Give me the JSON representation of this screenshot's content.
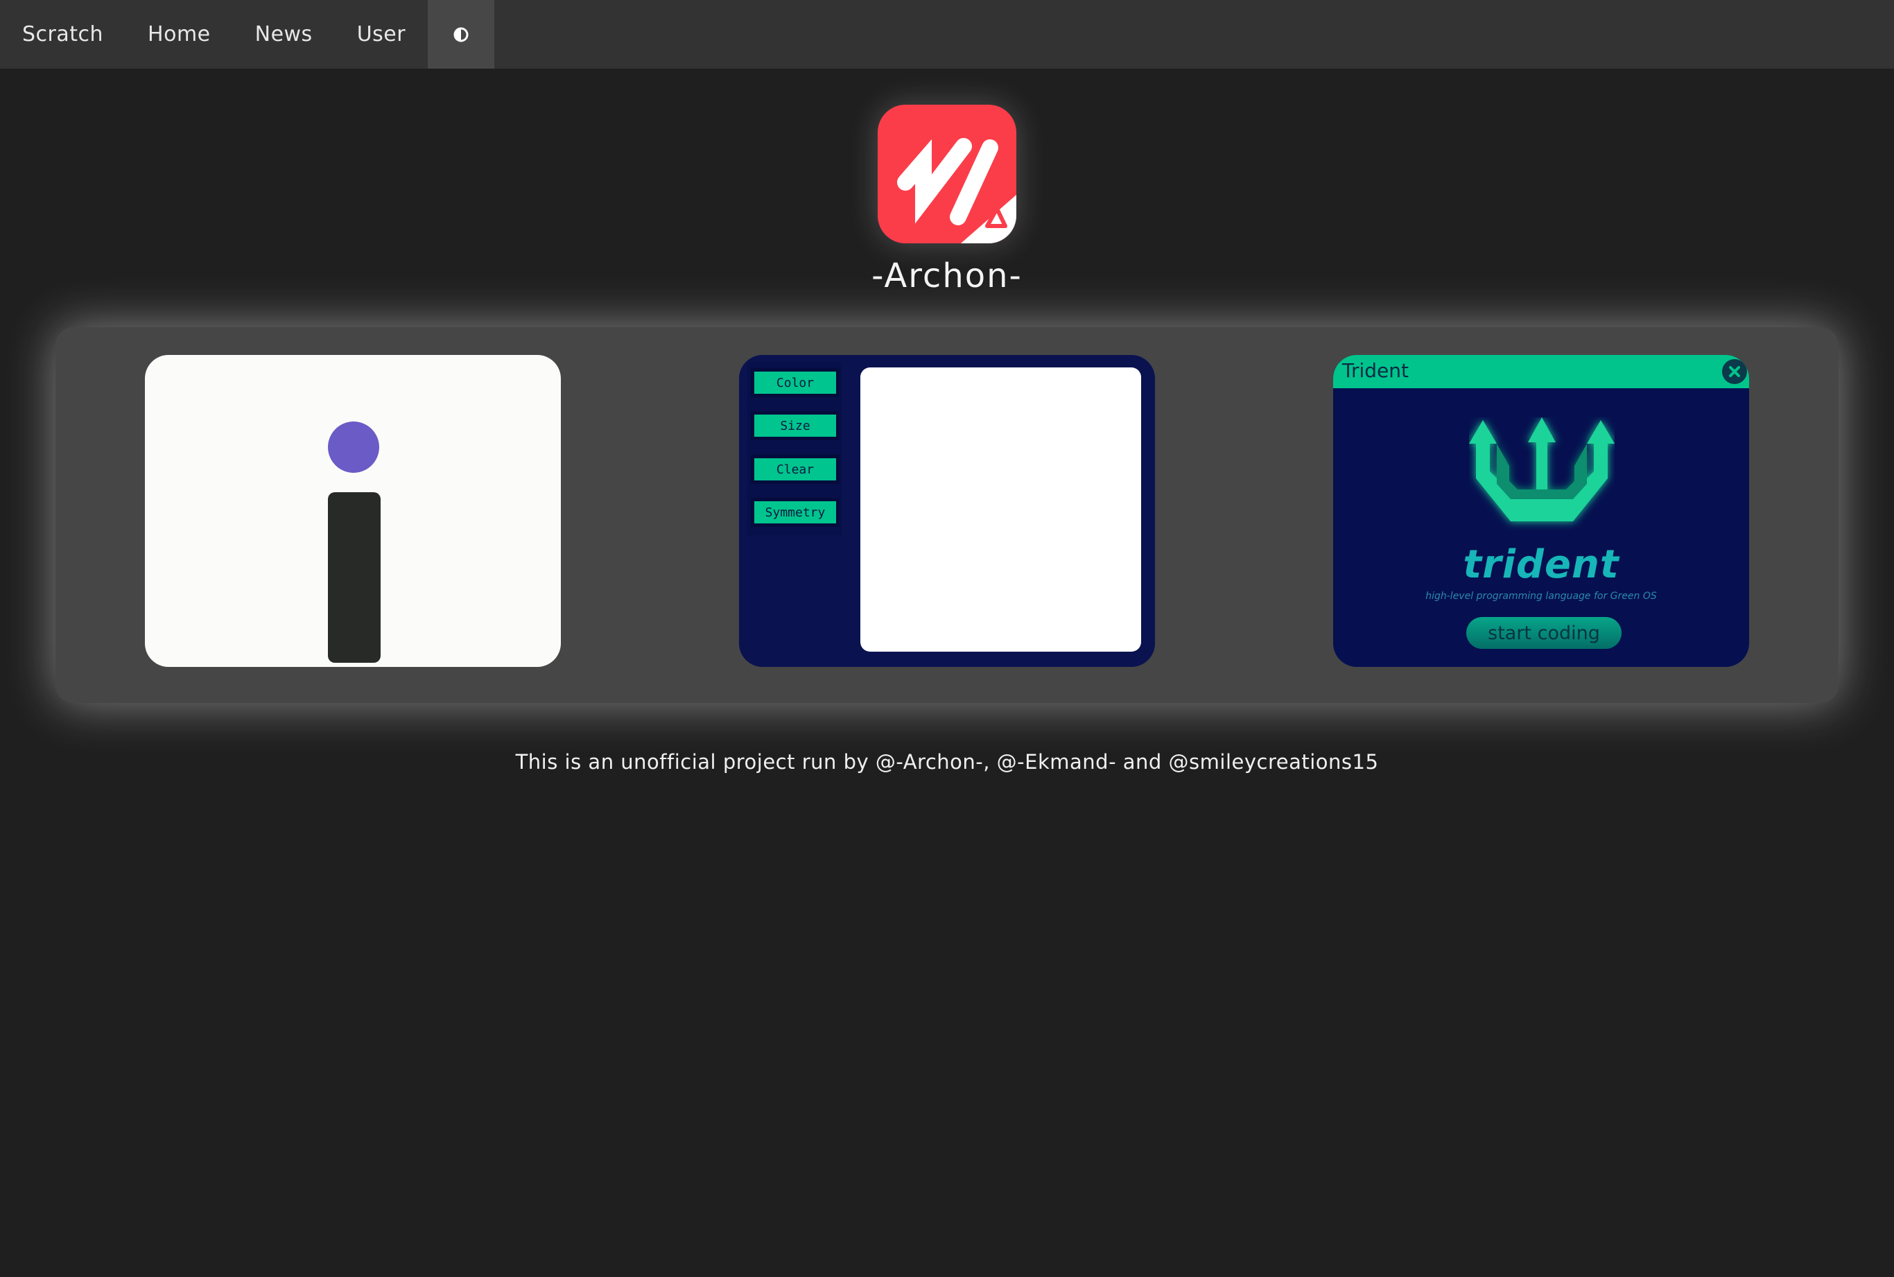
{
  "nav": {
    "items": [
      {
        "label": "Scratch"
      },
      {
        "label": "Home"
      },
      {
        "label": "News"
      },
      {
        "label": "User"
      }
    ],
    "theme_toggle_icon": "contrast-icon"
  },
  "brand": {
    "logo_icon": "archon-logo",
    "title": "-Archon-",
    "accent": "#fb3d4a"
  },
  "projects": {
    "paint": {
      "buttons": [
        "Color",
        "Size",
        "Clear",
        "Symmetry"
      ],
      "accent": "#00c58e"
    },
    "trident": {
      "window_title": "Trident",
      "wordmark": "trident",
      "tagline": "high-level programming language for Green OS",
      "start_label": "start coding",
      "accent": "#00c48c"
    }
  },
  "footer": {
    "text": "This is an unofficial project run by @-Archon-, @-Ekmand- and @smileycreations15"
  }
}
